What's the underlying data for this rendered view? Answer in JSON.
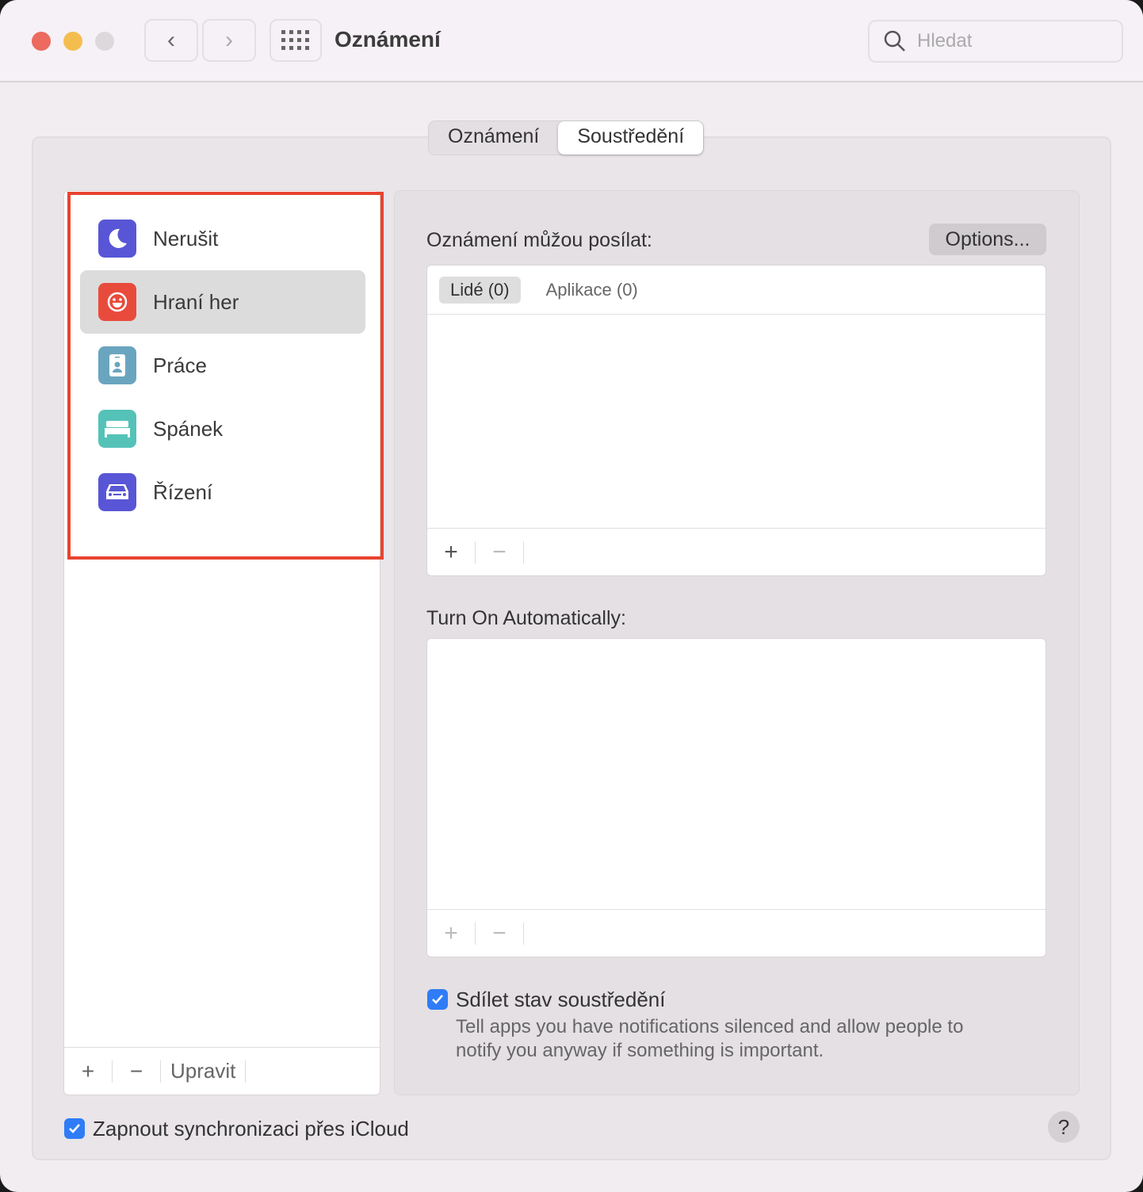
{
  "window": {
    "title": "Oznámení",
    "search_placeholder": "Hledat"
  },
  "tabs": [
    {
      "label": "Oznámení",
      "selected": false
    },
    {
      "label": "Soustředění",
      "selected": true
    }
  ],
  "focus_modes": [
    {
      "label": "Nerušit",
      "icon": "moon-icon",
      "color": "#5856d6"
    },
    {
      "label": "Hraní her",
      "icon": "smiley-icon",
      "color": "#e84b3c",
      "selected": true
    },
    {
      "label": "Práce",
      "icon": "id-badge-icon",
      "color": "#6aa5bf"
    },
    {
      "label": "Spánek",
      "icon": "bed-icon",
      "color": "#55c2b8"
    },
    {
      "label": "Řízení",
      "icon": "car-icon",
      "color": "#5856d6"
    }
  ],
  "list_footer": {
    "add": "+",
    "remove": "−",
    "edit": "Upravit"
  },
  "right": {
    "allowed_label": "Oznámení můžou posílat:",
    "options_button": "Options...",
    "subtabs": [
      "Lidé (0)",
      "Aplikace (0)"
    ],
    "auto_label": "Turn On Automatically:",
    "add": "+",
    "remove": "−",
    "share_label": "Sdílet stav soustředění",
    "share_checked": true,
    "share_desc_1": "Tell apps you have notifications silenced and allow people to",
    "share_desc_2": "notify you anyway if something is important."
  },
  "icloud": {
    "label": "Zapnout synchronizaci přes iCloud",
    "checked": true
  },
  "help": "?"
}
